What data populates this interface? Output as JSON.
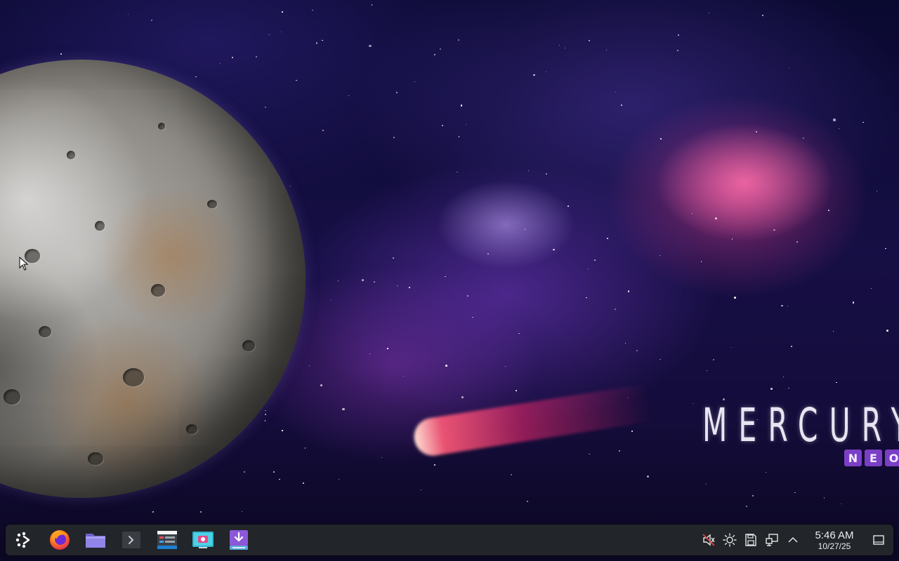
{
  "wallpaper": {
    "brand_title": "MERCURY",
    "brand_sub_letters": [
      "N",
      "E",
      "O"
    ],
    "accent_color": "#7b3fc6"
  },
  "taskbar": {
    "launcher_icon": "app-launcher-icon",
    "apps": [
      {
        "name": "Firefox",
        "icon": "firefox-icon"
      },
      {
        "name": "File Manager",
        "icon": "folder-icon"
      },
      {
        "name": "Terminal",
        "icon": "terminal-icon"
      },
      {
        "name": "System Monitor",
        "icon": "system-monitor-icon"
      },
      {
        "name": "Screenshot",
        "icon": "screenshot-icon"
      },
      {
        "name": "Software Center",
        "icon": "download-icon"
      }
    ],
    "tray": [
      "volume-muted-icon",
      "brightness-icon",
      "disk-icon",
      "network-icon",
      "chevron-up-icon"
    ],
    "clock": {
      "time": "5:46 AM",
      "date": "10/27/25"
    },
    "show_desktop_icon": "show-desktop-icon"
  }
}
